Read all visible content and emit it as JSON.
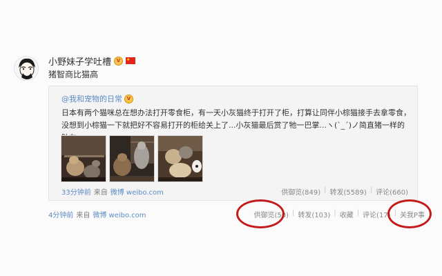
{
  "post": {
    "author": "小野妹子学吐槽",
    "vip_badge_label": "V",
    "flag_star": "★",
    "text": "猪智商比猫高",
    "time": "4分钟前",
    "source_prefix": "来自",
    "source_name": "微博 weibo.com",
    "actions": {
      "favorite": "供御览(50)",
      "repost": "转发(103)",
      "collect": "收藏",
      "comment": "评论(17)",
      "close": "关我P事"
    },
    "separator": "|"
  },
  "repost": {
    "author": "@我和宠物的日常",
    "vip_badge_label": "V",
    "text": "日本有两个猫咪总在想办法打开零食柜，有一天小灰猫终于打开了柜，打算让同伴小棕猫接手去拿零食，没想到小棕猫一下就把好不容易打开的柜给关上了...小灰猫最后赏了牠一巴掌...ヽ(ˋ_ˊ)ノ简直猪一样的队友...",
    "time": "33分钟前",
    "source_prefix": "来自",
    "source_name": "微博 weibo.com",
    "actions": {
      "favorite": "供御览(849)",
      "repost": "转发(5589)",
      "comment": "评论(660)"
    },
    "separator": "|"
  },
  "colors": {
    "link": "#5b8bc4",
    "annotation_circle": "#c41a1a",
    "repost_background": "#f4f4f4"
  },
  "icons": [
    "avatar-illustration",
    "vip-badge-icon",
    "china-flag-icon",
    "video-thumbnail-cats"
  ]
}
